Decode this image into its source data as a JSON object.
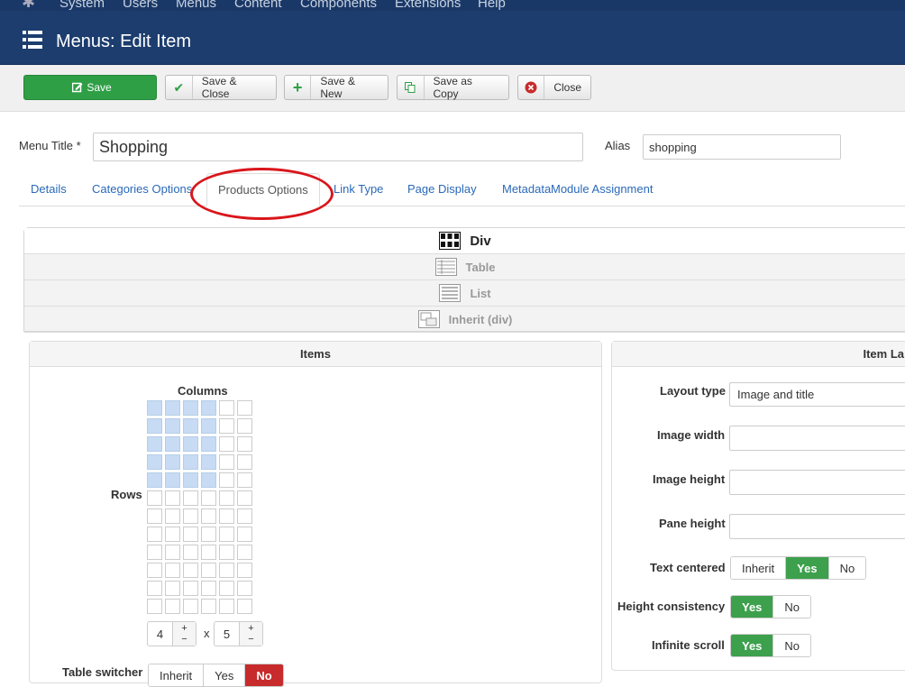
{
  "topnav": {
    "items": [
      "System",
      "Users",
      "Menus",
      "Content",
      "Components",
      "Extensions",
      "Help"
    ]
  },
  "header": {
    "title": "Menus: Edit Item"
  },
  "toolbar": {
    "save": "Save",
    "save_close": "Save & Close",
    "save_new": "Save & New",
    "save_copy": "Save as Copy",
    "close": "Close"
  },
  "form": {
    "menu_title_label": "Menu Title *",
    "menu_title_value": "Shopping",
    "alias_label": "Alias",
    "alias_value": "shopping"
  },
  "tabs": [
    "Details",
    "Categories Options",
    "Products Options",
    "Link Type",
    "Page Display",
    "Metadata",
    "Module Assignment"
  ],
  "layout_options": [
    "Div",
    "Table",
    "List",
    "Inherit (div)"
  ],
  "items_panel": {
    "title": "Items",
    "columns_label": "Columns",
    "rows_label": "Rows",
    "grid": {
      "cols": 6,
      "rows": 12,
      "selected_cols": 4,
      "selected_rows": 5
    },
    "columns_value": "4",
    "times": "x",
    "rows_value": "5",
    "plus": "+",
    "minus": "−",
    "table_switcher_label": "Table switcher",
    "table_switcher_options": [
      "Inherit",
      "Yes",
      "No"
    ]
  },
  "item_layout_panel": {
    "title": "Item La",
    "layout_type_label": "Layout type",
    "layout_type_value": "Image and title",
    "image_width_label": "Image width",
    "image_height_label": "Image height",
    "pane_height_label": "Pane height",
    "text_centered_label": "Text centered",
    "text_centered_options": [
      "Inherit",
      "Yes",
      "No"
    ],
    "height_consistency_label": "Height consistency",
    "height_consistency_options": [
      "Yes",
      "No"
    ],
    "infinite_scroll_label": "Infinite scroll",
    "infinite_scroll_options": [
      "Yes",
      "No"
    ]
  },
  "colors": {
    "header": "#1c3d6e",
    "save": "#2f9f46",
    "active_green": "#3ca04c",
    "active_red": "#c72b2b",
    "link": "#2a69b8",
    "highlight": "#d9161b"
  }
}
